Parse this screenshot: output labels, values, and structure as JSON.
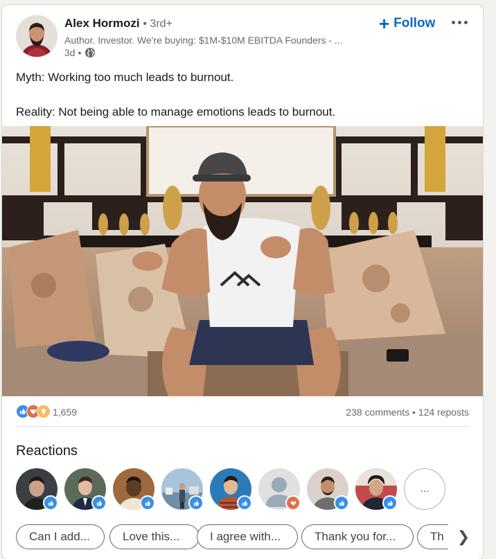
{
  "author": {
    "name": "Alex Hormozi",
    "degree": "• 3rd+",
    "headline": "Author. Investor. We're buying: $1M-$10M EBITDA Founders - ...",
    "time": "3d •",
    "visibility_icon": "globe-icon"
  },
  "follow": {
    "label": "Follow",
    "icon": "plus-icon"
  },
  "more_icon": "ellipsis-icon",
  "post": {
    "lines": [
      "Myth: Working too much leads to burnout.",
      "Reality: Not being able to manage emotions leads to burnout."
    ]
  },
  "media": {
    "type": "video-thumbnail"
  },
  "social": {
    "reaction_icons": [
      "like-icon",
      "love-icon",
      "insightful-icon"
    ],
    "reactions_count": "1,659",
    "comments": "238 comments",
    "separator": "•",
    "reposts": "124 reposts"
  },
  "reactions": {
    "title": "Reactions",
    "people": [
      {
        "badge": "like"
      },
      {
        "badge": "like"
      },
      {
        "badge": "like"
      },
      {
        "badge": "like"
      },
      {
        "badge": "like"
      },
      {
        "badge": "love"
      },
      {
        "badge": "like"
      },
      {
        "badge": "like"
      }
    ],
    "more_label": "..."
  },
  "suggestions": {
    "chips": [
      "Can I add...",
      "Love this...",
      "I agree with...",
      "Thank you for...",
      "Th"
    ],
    "next_icon": "chevron-right-icon"
  },
  "colors": {
    "accent": "#0a66c2",
    "like": "#378fe9",
    "love": "#df704d",
    "insightful": "#f5bb5c"
  }
}
